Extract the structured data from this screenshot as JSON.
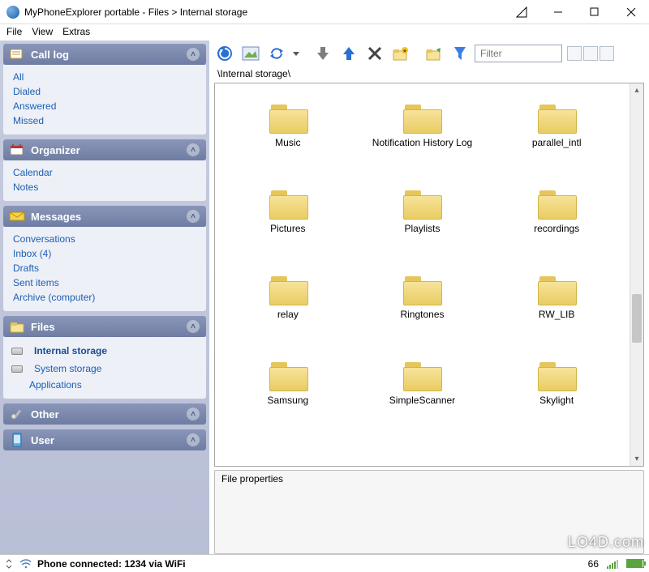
{
  "window": {
    "title": "MyPhoneExplorer portable  -  Files > Internal storage"
  },
  "menu": {
    "file": "File",
    "view": "View",
    "extras": "Extras"
  },
  "sidebar": {
    "calllog": {
      "title": "Call log",
      "items": [
        "All",
        "Dialed",
        "Answered",
        "Missed"
      ]
    },
    "organizer": {
      "title": "Organizer",
      "items": [
        "Calendar",
        "Notes"
      ]
    },
    "messages": {
      "title": "Messages",
      "items": [
        "Conversations",
        "Inbox (4)",
        "Drafts",
        "Sent items",
        "Archive (computer)"
      ]
    },
    "files": {
      "title": "Files",
      "items": [
        "Internal storage",
        "System storage",
        "Applications"
      ],
      "active_index": 0
    },
    "other": {
      "title": "Other"
    },
    "user": {
      "title": "User"
    }
  },
  "toolbar": {
    "filter_placeholder": "Filter"
  },
  "breadcrumb": "\\Internal storage\\",
  "folders": [
    "Music",
    "Notification History Log",
    "parallel_intl",
    "Pictures",
    "Playlists",
    "recordings",
    "relay",
    "Ringtones",
    "RW_LIB",
    "Samsung",
    "SimpleScanner",
    "Skylight"
  ],
  "properties_title": "File properties",
  "status": {
    "text": "Phone connected: 1234 via WiFi",
    "signal": "66"
  },
  "watermark": "LO4D.com"
}
